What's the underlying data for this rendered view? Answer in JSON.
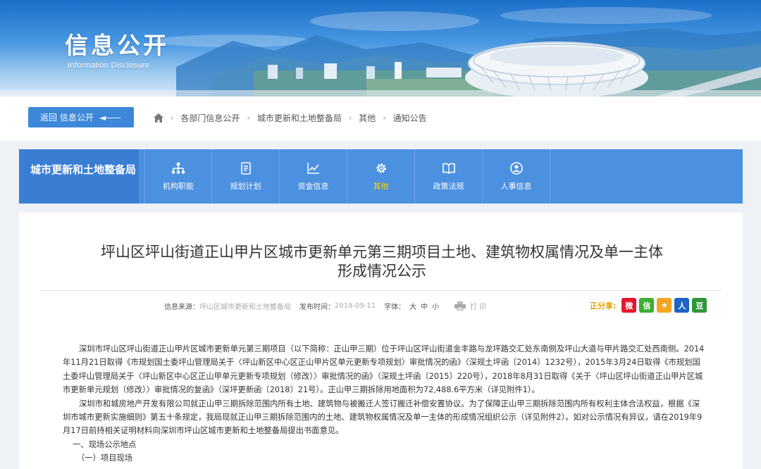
{
  "banner": {
    "title_cn": "信息公开",
    "title_en": "Information  Disclosure"
  },
  "breadcrumb": {
    "back_label": "返回 信息公开",
    "back_arrow": "◄——",
    "items": [
      "各部门信息公开",
      "城市更新和土地整备局",
      "其他",
      "通知公告"
    ]
  },
  "dept_nav": {
    "title": "城市更新和土地整备局",
    "items": [
      {
        "label": "机构职能",
        "icon": "org-chart-icon"
      },
      {
        "label": "规划计划",
        "icon": "document-icon"
      },
      {
        "label": "资金信息",
        "icon": "line-chart-icon"
      },
      {
        "label": "其他",
        "icon": "gear-icon",
        "active": true
      },
      {
        "label": "政策法规",
        "icon": "book-icon"
      },
      {
        "label": "人事信息",
        "icon": "person-icon"
      }
    ],
    "colors": {
      "bar": "#4c90e0",
      "title_bg": "#3a7ed4",
      "active": "#ffd400"
    }
  },
  "article": {
    "title_line1": "坪山区坪山街道正山甲片区城市更新单元第三期项目土地、建筑物权属情况及单一主体",
    "title_line2": "形成情况公示",
    "source_label": "信息来源：",
    "source": "坪山区城市更新和土地整备局",
    "time_label": "发布时间：",
    "time": "2019-09-11",
    "size_label": "字体：",
    "sizes": [
      "大",
      "中",
      "小"
    ],
    "print_label": "打 印",
    "share_label": "正分享:",
    "share_icons": [
      {
        "name": "weibo-icon",
        "glyph": "微",
        "color": "#e6162d"
      },
      {
        "name": "wechat-icon",
        "glyph": "信",
        "color": "#3cb034"
      },
      {
        "name": "qzone-icon",
        "glyph": "★",
        "color": "#f5a623"
      },
      {
        "name": "renren-icon",
        "glyph": "人",
        "color": "#1d64c7"
      },
      {
        "name": "douban-icon",
        "glyph": "豆",
        "color": "#2e963d"
      }
    ],
    "paragraphs": [
      "深圳市坪山区坪山街道正山甲片区城市更新单元第三期项目（以下简称：正山甲三期）位于坪山区坪山街道金丰路与龙坪路交汇处东南侧及坪山大道与甲片路交汇处西南侧。2014年11月21日取得《市规划国土委坪山管理局关于〈坪山新区中心区正山甲片区单元更新专项规划〉审批情况的函》（深规土坪函〔2014〕1232号），2015年3月24日取得《市规划国土委坪山管理局关于〈坪山新区中心区正山甲单元更新专项规划（修改）〉审批情况的函》（深规土坪函〔2015〕220号），2018年8月31日取得《关于〈坪山区坪山街道正山甲片区城市更新单元规划（修改）〉审批情况的复函》（深坪更新函〔2018〕21号）。正山甲三期拆除用地面积为72,488.6平方米（详见附件1）。",
      "深圳市和城房地产开发有限公司就正山甲三期拆除范围内所有土地、建筑物与被搬迁人签订搬迁补偿安置协议。为了保障正山甲三期拆除范围内所有权利主体合法权益，根据《深圳市城市更新实施细则》第五十条规定，我局现就正山甲三期拆除范围内的土地、建筑物权属情况及单一主体的形成情况组织公示（详见附件2）。如对公示情况有异议，请在2019年9月17日前持相关证明材料向深圳市坪山区城市更新和土地整备局提出书面意见。"
    ],
    "heading1": "一、现场公示地点",
    "heading2": "（一）项目现场"
  }
}
